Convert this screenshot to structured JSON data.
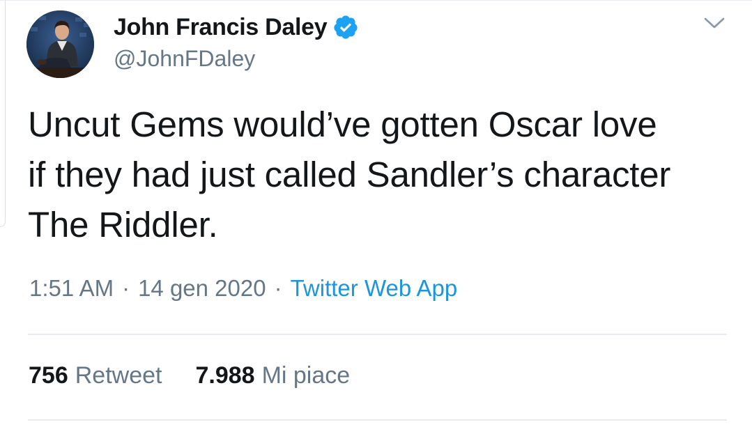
{
  "tweet": {
    "author": {
      "display_name": "John Francis Daley",
      "handle": "@JohnFDaley",
      "verified": true,
      "verified_icon": "verified-badge-icon",
      "verified_color": "#1da1f2"
    },
    "menu_icon": "chevron-down-icon",
    "text_lines": [
      "Uncut Gems would’ve gotten Oscar love",
      "if they had just called Sandler’s character",
      "The Riddler."
    ],
    "meta": {
      "time": "1:51 AM",
      "separator": "·",
      "date": "14 gen 2020",
      "source": "Twitter Web App"
    },
    "stats": {
      "retweets_count": "756",
      "retweets_label": "Retweet",
      "likes_count": "7.988",
      "likes_label": "Mi piace"
    }
  },
  "colors": {
    "text": "#14171a",
    "secondary": "#657786",
    "link": "#1b95e0",
    "divider": "#e6ecf0"
  }
}
